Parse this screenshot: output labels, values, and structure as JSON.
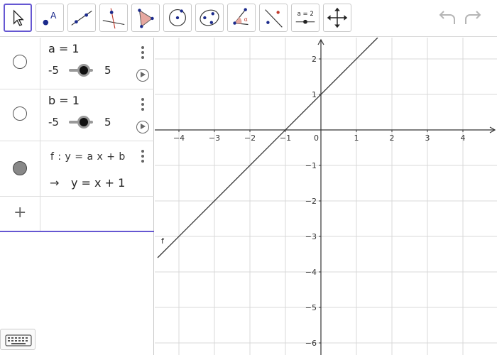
{
  "toolbar": {
    "tools": [
      {
        "name": "move-tool",
        "icon": "pointer-arrow-icon"
      },
      {
        "name": "point-tool",
        "icon": "point-with-label-icon"
      },
      {
        "name": "line-tool",
        "icon": "line-through-points-icon"
      },
      {
        "name": "perpendicular-line-tool",
        "icon": "perpendicular-line-icon"
      },
      {
        "name": "polygon-tool",
        "icon": "polygon-icon"
      },
      {
        "name": "circle-center-point-tool",
        "icon": "circle-center-icon"
      },
      {
        "name": "conic-tool",
        "icon": "ellipse-icon"
      },
      {
        "name": "angle-tool",
        "icon": "angle-icon"
      },
      {
        "name": "reflect-tool",
        "icon": "reflect-about-line-icon"
      },
      {
        "name": "slider-tool",
        "icon": "slider-icon",
        "label": "a = 2"
      },
      {
        "name": "move-graphics-view-tool",
        "icon": "move-cross-arrows-icon"
      }
    ],
    "undo_icon": "undo-icon",
    "redo_icon": "redo-icon"
  },
  "algebra": {
    "sliders": [
      {
        "name": "a = 1",
        "min": "-5",
        "max": "5",
        "value": 1
      },
      {
        "name": "b = 1",
        "min": "-5",
        "max": "5",
        "value": 1
      }
    ],
    "function": {
      "definition": "f : y = a x + b",
      "arrow": "→",
      "output": "y = x + 1"
    },
    "add_label": "+"
  },
  "graphics": {
    "x_ticks": [
      "−4",
      "−3",
      "−2",
      "−1",
      "0",
      "1",
      "2",
      "3",
      "4"
    ],
    "y_ticks": [
      "2",
      "1",
      "−1",
      "−2",
      "−3",
      "−4",
      "−5",
      "−6"
    ],
    "function_label": "f",
    "grid": true,
    "axis_color": "#333333",
    "grid_color": "#d9d9d9",
    "line_color": "#333333"
  },
  "chart_data": {
    "type": "line",
    "series": [
      {
        "name": "f",
        "x": [
          -4.6,
          1.6
        ],
        "y": [
          -3.6,
          2.6
        ]
      }
    ],
    "xlim": [
      -4.6,
      4.8
    ],
    "ylim": [
      -6.2,
      2.7
    ],
    "grid": true
  },
  "colors": {
    "accent": "#6557d2",
    "selected_tool_border": "#6557d2"
  }
}
